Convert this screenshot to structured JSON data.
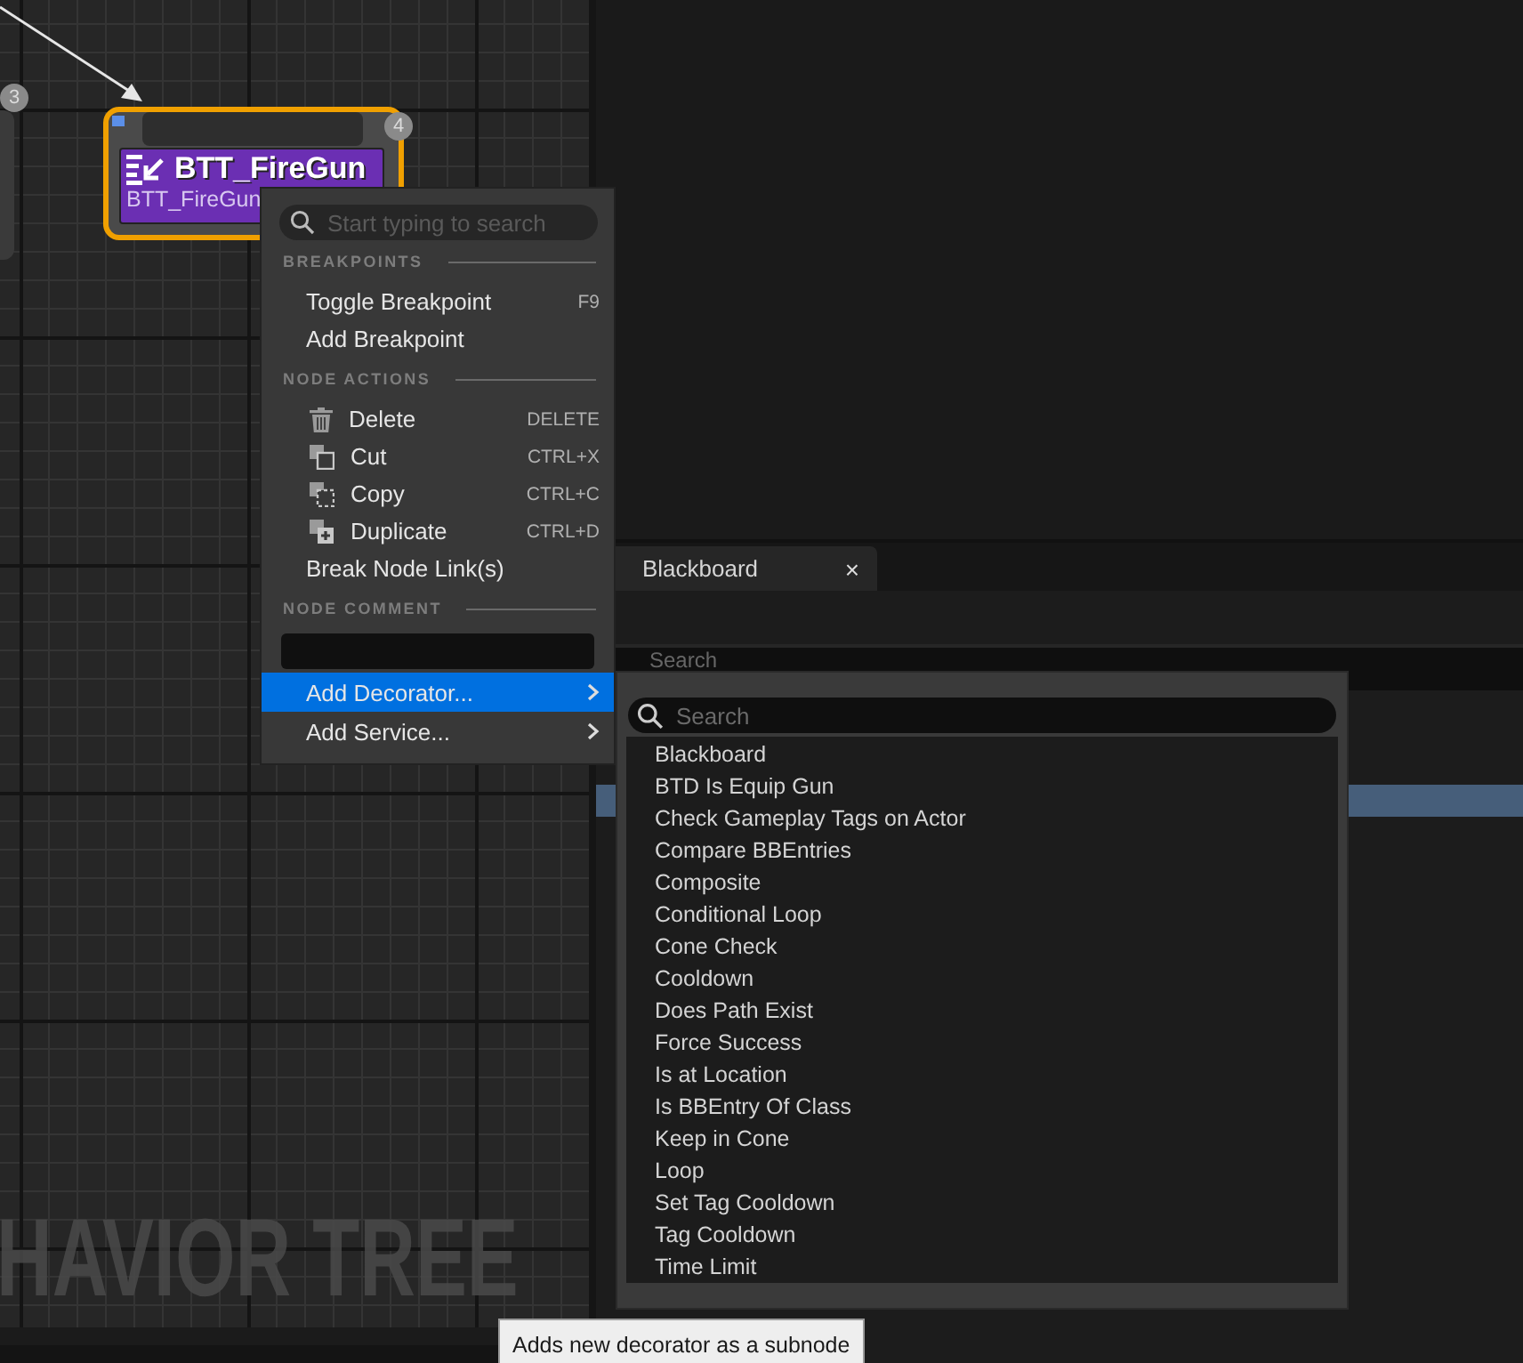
{
  "graph": {
    "watermark": "HAVIOR TREE",
    "side_node": {
      "badge": "3"
    },
    "task_node": {
      "badge": "4",
      "title": "BTT_FireGun",
      "subtitle": "BTT_FireGun",
      "selected": true
    }
  },
  "blackboard_panel": {
    "tab": {
      "label": "Blackboard",
      "close": "×"
    },
    "search": {
      "placeholder": "Search"
    }
  },
  "context_menu": {
    "search": {
      "placeholder": "Start typing to search"
    },
    "sections": [
      {
        "heading": "BREAKPOINTS",
        "items": [
          {
            "label": "Toggle Breakpoint",
            "shortcut": "F9"
          },
          {
            "label": "Add Breakpoint"
          }
        ]
      },
      {
        "heading": "NODE ACTIONS",
        "items": [
          {
            "kind": "icon",
            "label": "Delete",
            "shortcut": "DELETE"
          },
          {
            "kind": "icon",
            "label": "Cut",
            "shortcut": "CTRL+X"
          },
          {
            "kind": "icon",
            "label": "Copy",
            "shortcut": "CTRL+C"
          },
          {
            "kind": "icon",
            "label": "Duplicate",
            "shortcut": "CTRL+D"
          },
          {
            "kind": "plain",
            "label": "Break Node Link(s)"
          }
        ]
      }
    ],
    "node_comment": {
      "heading": "NODE COMMENT"
    },
    "submenus": [
      {
        "label": "Add Decorator...",
        "selected": true
      },
      {
        "label": "Add Service...",
        "selected": false
      }
    ]
  },
  "decorator_submenu": {
    "search": {
      "placeholder": "Search"
    },
    "items": [
      "Blackboard",
      "BTD Is Equip Gun",
      "Check Gameplay Tags on Actor",
      "Compare BBEntries",
      "Composite",
      "Conditional Loop",
      "Cone Check",
      "Cooldown",
      "Does Path Exist",
      "Force Success",
      "Is at Location",
      "Is BBEntry Of Class",
      "Keep in Cone",
      "Loop",
      "Set Tag Cooldown",
      "Tag Cooldown",
      "Time Limit"
    ]
  },
  "tooltip": "Adds new decorator as a subnode"
}
